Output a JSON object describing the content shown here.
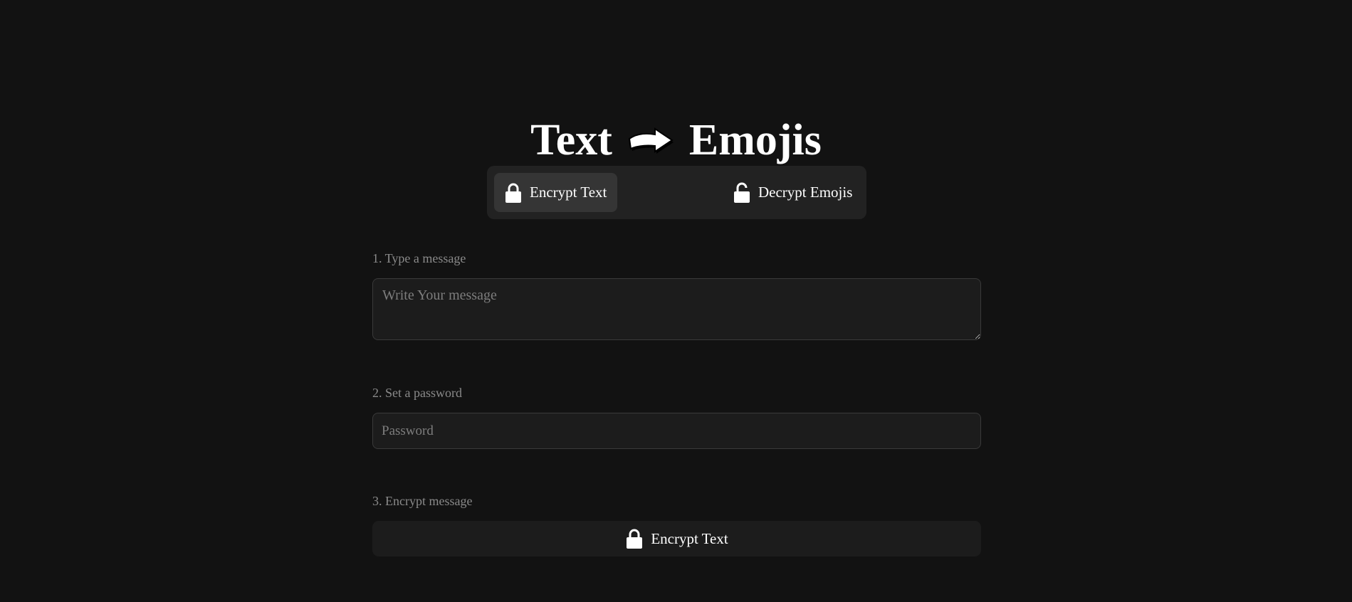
{
  "header": {
    "title_left": "Text",
    "title_right": "Emojis",
    "arrow_icon": "right-arrow-emoji"
  },
  "mode_switch": {
    "encrypt_label": "Encrypt Text",
    "decrypt_label": "Decrypt Emojis",
    "active": "encrypt"
  },
  "form": {
    "step1_label": "1. Type a message",
    "message_placeholder": "Write Your message",
    "message_value": "",
    "step2_label": "2. Set a password",
    "password_placeholder": "Password",
    "password_value": "",
    "step3_label": "3. Encrypt message",
    "submit_label": "Encrypt Text"
  },
  "colors": {
    "background": "#121212",
    "panel": "#222222",
    "active_tab": "#353535",
    "field": "#1c1c1c",
    "muted_text": "#8a8a8a"
  }
}
